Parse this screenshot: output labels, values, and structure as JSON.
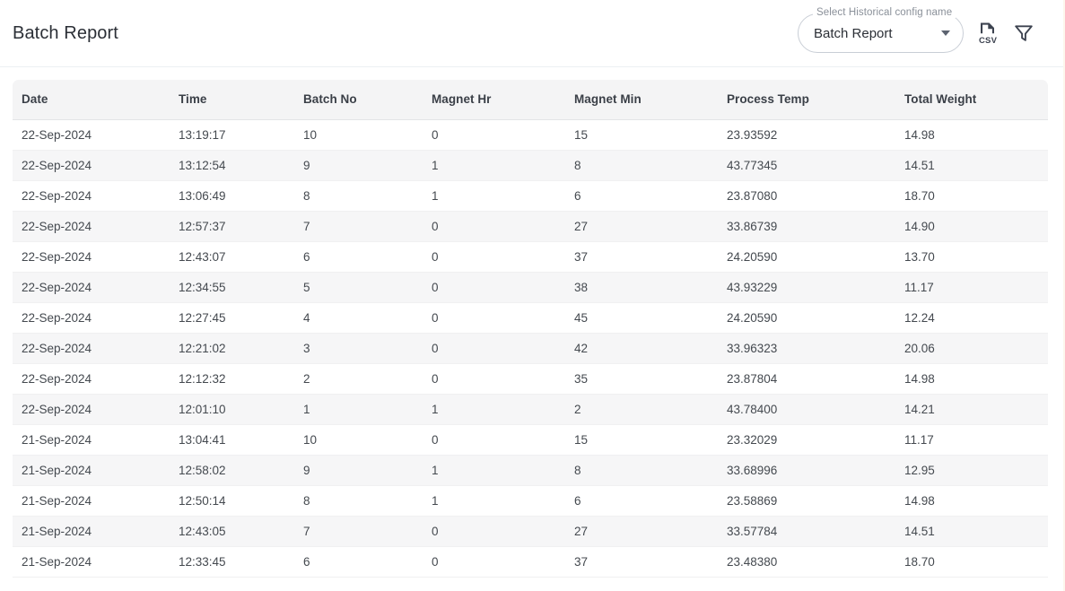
{
  "header": {
    "title": "Batch Report",
    "select": {
      "label": "Select Historical config name",
      "value": "Batch Report"
    },
    "csv_icon_name": "csv-export-icon",
    "filter_icon_name": "filter-icon"
  },
  "table": {
    "columns": [
      "Date",
      "Time",
      "Batch No",
      "Magnet Hr",
      "Magnet Min",
      "Process Temp",
      "Total Weight"
    ],
    "rows": [
      [
        "22-Sep-2024",
        "13:19:17",
        "10",
        "0",
        "15",
        "23.93592",
        "14.98"
      ],
      [
        "22-Sep-2024",
        "13:12:54",
        "9",
        "1",
        "8",
        "43.77345",
        "14.51"
      ],
      [
        "22-Sep-2024",
        "13:06:49",
        "8",
        "1",
        "6",
        "23.87080",
        "18.70"
      ],
      [
        "22-Sep-2024",
        "12:57:37",
        "7",
        "0",
        "27",
        "33.86739",
        "14.90"
      ],
      [
        "22-Sep-2024",
        "12:43:07",
        "6",
        "0",
        "37",
        "24.20590",
        "13.70"
      ],
      [
        "22-Sep-2024",
        "12:34:55",
        "5",
        "0",
        "38",
        "43.93229",
        "11.17"
      ],
      [
        "22-Sep-2024",
        "12:27:45",
        "4",
        "0",
        "45",
        "24.20590",
        "12.24"
      ],
      [
        "22-Sep-2024",
        "12:21:02",
        "3",
        "0",
        "42",
        "33.96323",
        "20.06"
      ],
      [
        "22-Sep-2024",
        "12:12:32",
        "2",
        "0",
        "35",
        "23.87804",
        "14.98"
      ],
      [
        "22-Sep-2024",
        "12:01:10",
        "1",
        "1",
        "2",
        "43.78400",
        "14.21"
      ],
      [
        "21-Sep-2024",
        "13:04:41",
        "10",
        "0",
        "15",
        "23.32029",
        "11.17"
      ],
      [
        "21-Sep-2024",
        "12:58:02",
        "9",
        "1",
        "8",
        "33.68996",
        "12.95"
      ],
      [
        "21-Sep-2024",
        "12:50:14",
        "8",
        "1",
        "6",
        "23.58869",
        "14.98"
      ],
      [
        "21-Sep-2024",
        "12:43:05",
        "7",
        "0",
        "27",
        "33.57784",
        "14.51"
      ],
      [
        "21-Sep-2024",
        "12:33:45",
        "6",
        "0",
        "37",
        "23.48380",
        "18.70"
      ]
    ]
  },
  "colors": {
    "header_bg": "#f4f4f5",
    "stripe_bg": "#f6f6f7",
    "text": "#44494f",
    "icon": "#3d4350",
    "divider": "#eceff3"
  }
}
